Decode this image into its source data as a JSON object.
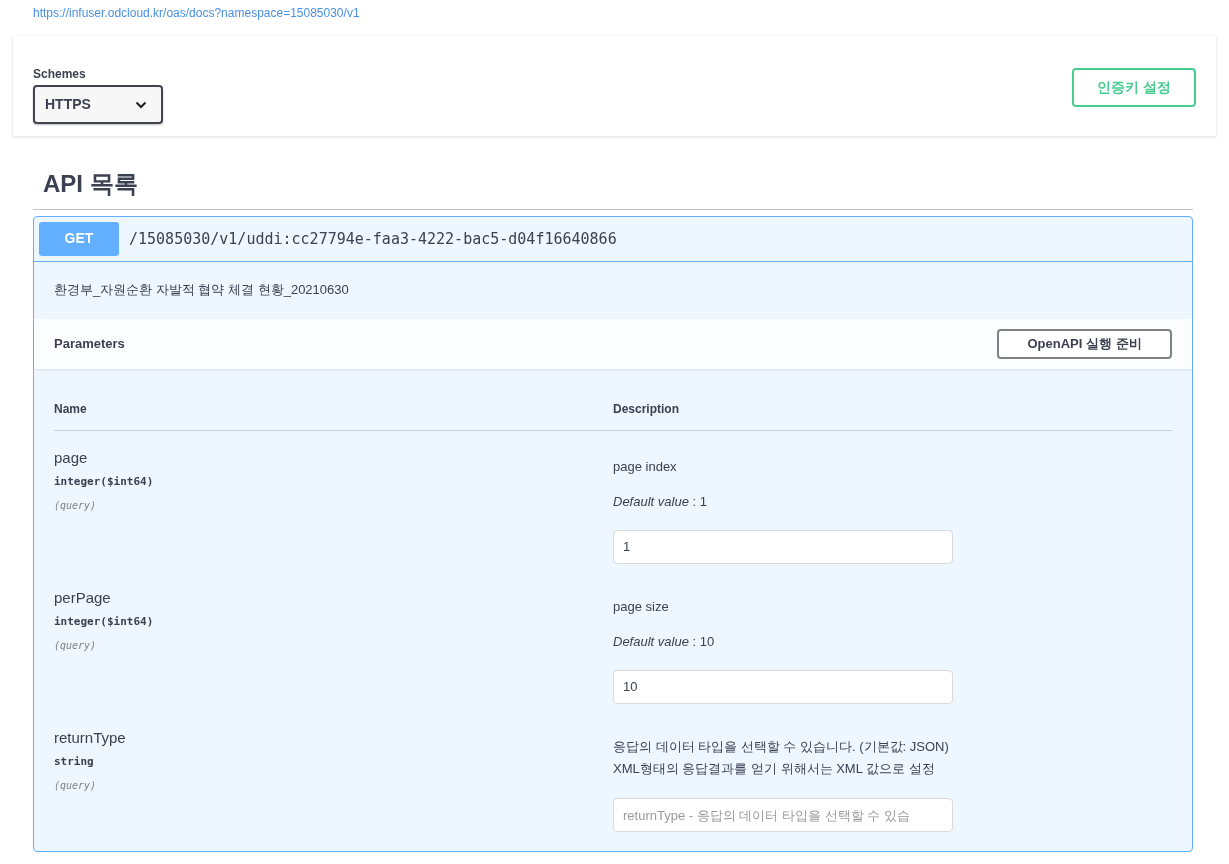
{
  "url": "https://infuser.odcloud.kr/oas/docs?namespace=15085030/v1",
  "schemes": {
    "label": "Schemes",
    "value": "HTTPS"
  },
  "auth_button": "인증키 설정",
  "section_title": "API 목록",
  "operation": {
    "method": "GET",
    "path": "/15085030/v1/uddi:cc27794e-faa3-4222-bac5-d04f16640866",
    "summary": "환경부_자원순환 자발적 협약 체결 현황_20210630",
    "expanded": true
  },
  "parameters": {
    "title": "Parameters",
    "try_button": "OpenAPI 실행 준비",
    "columns": [
      "Name",
      "Description"
    ],
    "rows": [
      {
        "name": "page",
        "type": "integer($int64)",
        "location": "(query)",
        "description": [
          "page index"
        ],
        "default": "*Default value* : 1",
        "value": "1"
      },
      {
        "name": "perPage",
        "type": "integer($int64)",
        "location": "(query)",
        "description": [
          "page size"
        ],
        "default": "*Default value* : 10",
        "value": "10"
      },
      {
        "name": "returnType",
        "type": "string",
        "location": "(query)",
        "description": [
          "응답의 데이터 타입을 선택할 수 있습니다. (기본값: JSON)",
          "XML형태의 응답결과를 얻기 위해서는 XML 값으로 설정"
        ],
        "placeholder": "returnType - 응답의 데이터 타입을 선택할 수 있습"
      }
    ]
  }
}
